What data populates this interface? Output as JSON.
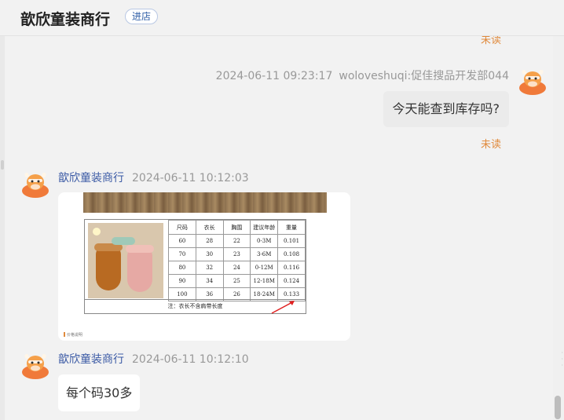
{
  "header": {
    "shop_name": "歆欣童装商行",
    "enter_store_label": "进店"
  },
  "messages": {
    "cut_text": "未读",
    "outgoing": {
      "time": "2024-06-11 09:23:17",
      "sender": "woloveshuqi:促佳搜品开发部044",
      "text": "今天能查到库存吗?",
      "status": "未读"
    },
    "image_msg": {
      "sender": "歆欣童装商行",
      "time": "2024-06-11 10:12:03",
      "table_headers": [
        "尺码",
        "衣长",
        "胸围",
        "建议年龄",
        "重量"
      ],
      "table_rows": [
        [
          "60",
          "28",
          "22",
          "0-3M",
          "0.101"
        ],
        [
          "70",
          "30",
          "23",
          "3-6M",
          "0.108"
        ],
        [
          "80",
          "32",
          "24",
          "0-12M",
          "0.116"
        ],
        [
          "90",
          "34",
          "25",
          "12-18M",
          "0.124"
        ],
        [
          "100",
          "36",
          "26",
          "18-24M",
          "0.133"
        ]
      ],
      "table_note": "注：衣长不含肩带长度",
      "caption": "价格说明"
    },
    "text_msg": {
      "sender": "歆欣童装商行",
      "time": "2024-06-11 10:12:10",
      "text": "每个码30多"
    }
  },
  "colors": {
    "accent_orange": "#e08a3c",
    "name_blue": "#3b5aa5",
    "avatar_orange": "#f07a3a"
  },
  "icons": {
    "avatar": "cow-head-avatar-icon",
    "arrow": "red-arrow-icon"
  }
}
